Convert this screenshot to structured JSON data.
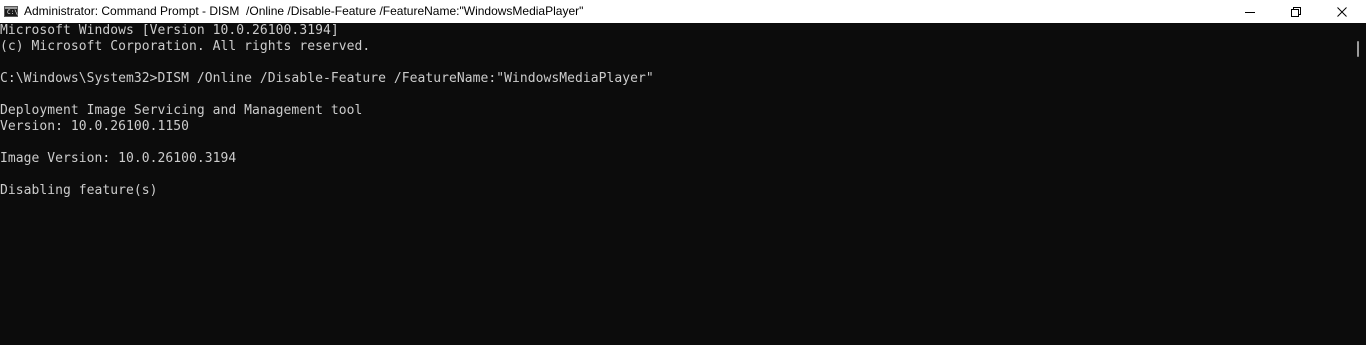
{
  "window": {
    "title": "Administrator: Command Prompt - DISM  /Online /Disable-Feature /FeatureName:\"WindowsMediaPlayer\"",
    "icon": "command-prompt-icon",
    "icon_text": "C:\\",
    "controls": {
      "minimize": "minimize-icon",
      "maximize": "restore-icon",
      "close": "close-icon"
    }
  },
  "console": {
    "lines": [
      "Microsoft Windows [Version 10.0.26100.3194]",
      "(c) Microsoft Corporation. All rights reserved.",
      "",
      "C:\\Windows\\System32>DISM /Online /Disable-Feature /FeatureName:\"WindowsMediaPlayer\"",
      "",
      "Deployment Image Servicing and Management tool",
      "Version: 10.0.26100.1150",
      "",
      "Image Version: 10.0.26100.3194",
      "",
      "Disabling feature(s)"
    ]
  },
  "colors": {
    "background": "#0c0c0c",
    "text": "#cccccc",
    "titlebar": "#ffffff"
  }
}
